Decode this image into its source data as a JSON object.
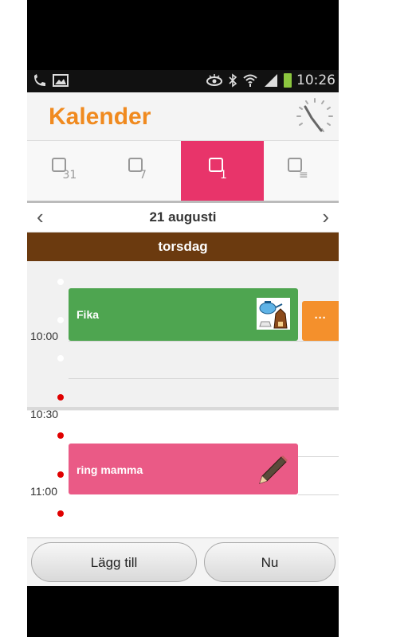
{
  "status_bar": {
    "time": "10:26",
    "icons": [
      "missed-call-icon",
      "image-icon",
      "eye-icon",
      "bluetooth-icon",
      "wifi-icon",
      "signal-icon",
      "battery-icon"
    ]
  },
  "app": {
    "title": "Kalender"
  },
  "tabs": [
    {
      "name": "month",
      "number": "31",
      "active": false
    },
    {
      "name": "week",
      "number": "7",
      "active": false
    },
    {
      "name": "day",
      "number": "1",
      "active": true
    },
    {
      "name": "list",
      "number": "≡",
      "active": false
    }
  ],
  "date_nav": {
    "date": "21 augusti",
    "prev": "‹",
    "next": "›"
  },
  "day_name": "torsdag",
  "time_labels": [
    "10:00",
    "10:30",
    "11:00"
  ],
  "events": {
    "fika": {
      "title": "Fika",
      "color": "#4ea550"
    },
    "ring_mamma": {
      "title": "ring mamma",
      "color": "#ea5a86"
    },
    "more": {
      "label": "···",
      "color": "#f4902c"
    }
  },
  "accent_color": "#e8346a",
  "buttons": {
    "add": "Lägg till",
    "now": "Nu"
  }
}
